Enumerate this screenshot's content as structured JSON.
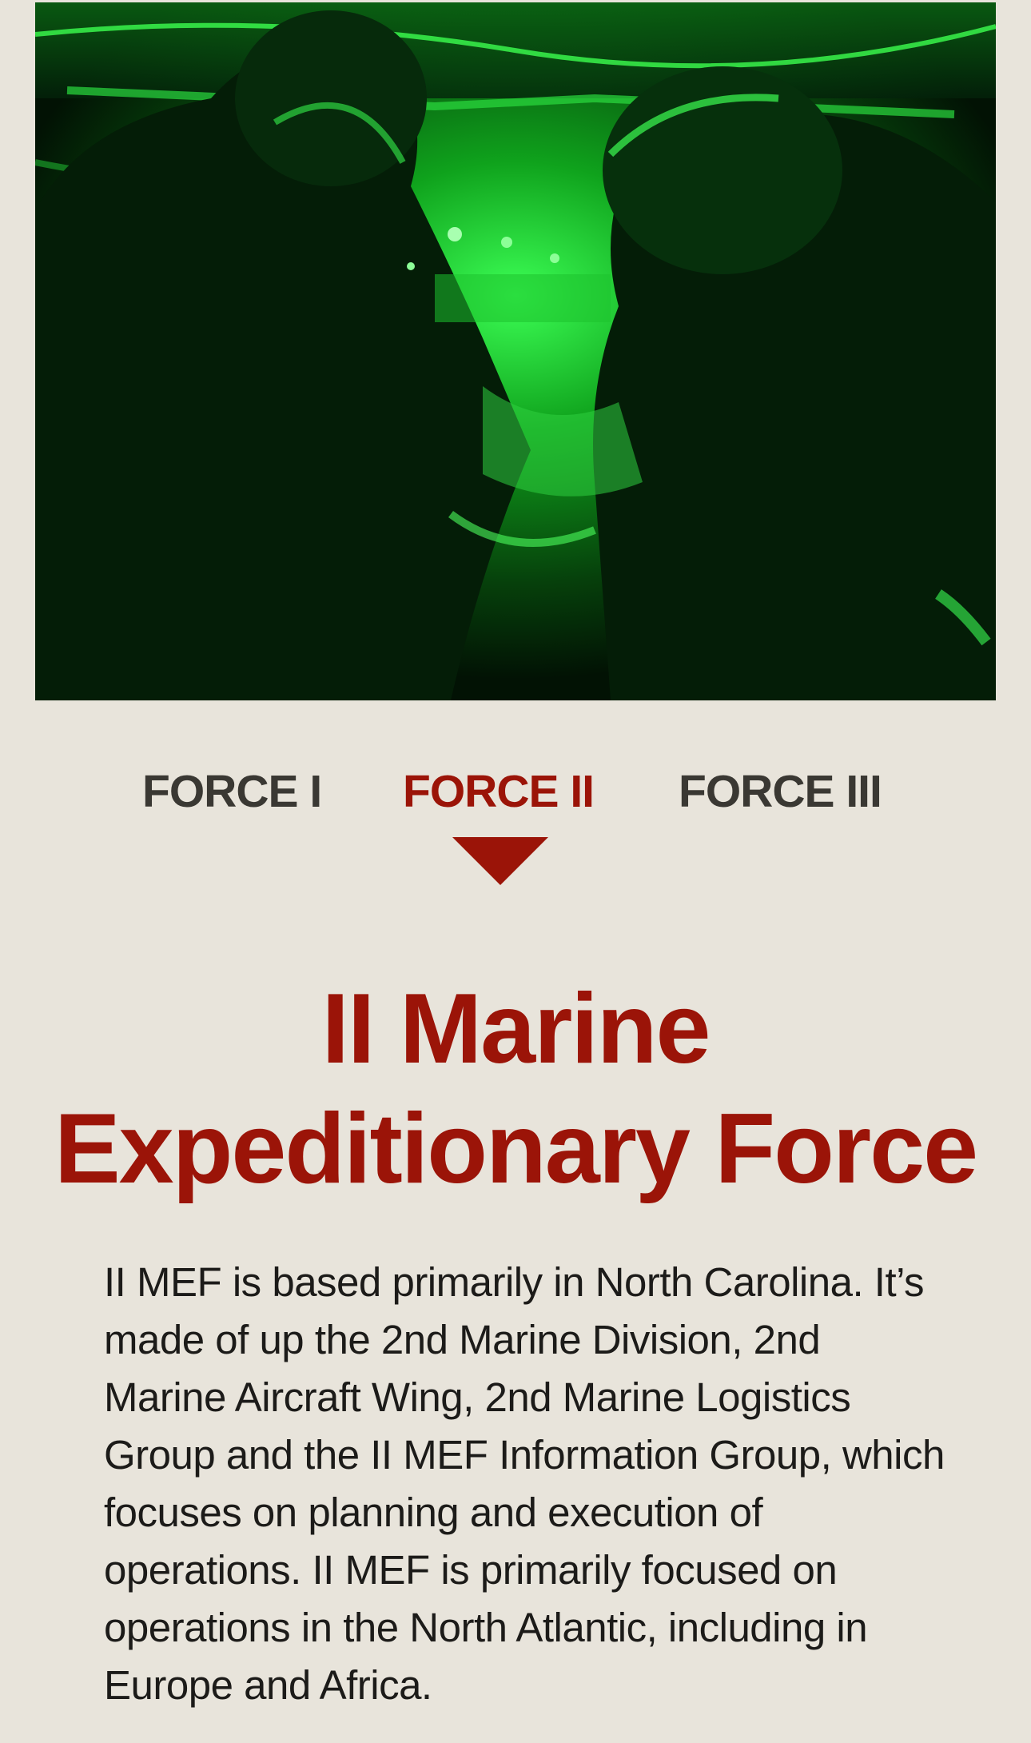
{
  "hero": {
    "image_alt": "Marines in a vehicle viewed through night vision",
    "tint_color": "#1fd62e"
  },
  "tabs": [
    {
      "label": "FORCE I",
      "active": false
    },
    {
      "label": "FORCE II",
      "active": true
    },
    {
      "label": "FORCE III",
      "active": false
    }
  ],
  "colors": {
    "accent": "#9b1408",
    "background": "#e8e4db",
    "tab_inactive": "#3a3833"
  },
  "content": {
    "title_line1": "II Marine",
    "title_line2": "Expeditionary Force",
    "description": "II MEF is based primarily in North Carolina. It’s made of up the 2nd Marine Division, 2nd Marine Aircraft Wing, 2nd Marine Logistics Group and the II MEF Information Group, which focuses on planning and execution of operations. II MEF is primarily focused on operations in the North Atlantic, including in Europe and Africa."
  }
}
